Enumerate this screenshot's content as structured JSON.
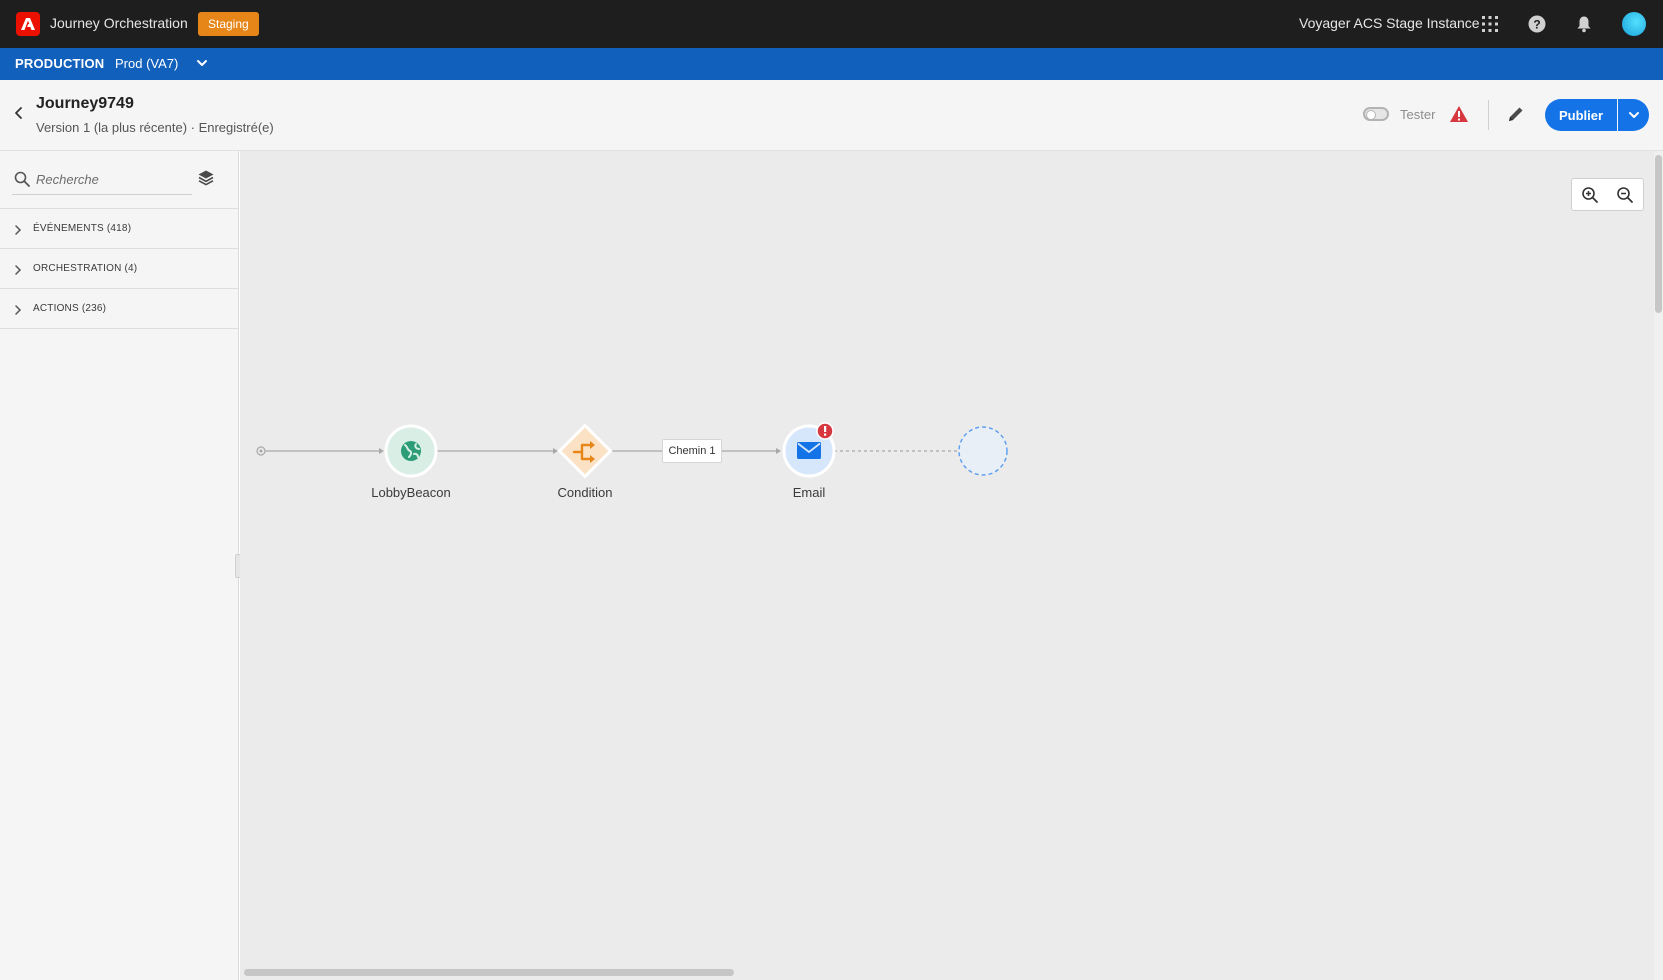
{
  "topbar": {
    "app_title": "Journey Orchestration",
    "env_badge": "Staging",
    "instance_name": "Voyager ACS Stage Instance",
    "icons": [
      "app-switcher-icon",
      "help-icon",
      "notifications-icon",
      "avatar"
    ]
  },
  "orgbar": {
    "environment": "PRODUCTION",
    "sandbox": "Prod (VA7)"
  },
  "journey": {
    "name": "Journey9749",
    "version": "Version 1 (la plus récente) · Enregistré(e)",
    "tester_label": "Tester",
    "tester_enabled": false,
    "publish_label": "Publier"
  },
  "left_panel": {
    "search_placeholder": "Recherche",
    "categories": [
      {
        "label": "ÉVÉNEMENTS (418)"
      },
      {
        "label": "ORCHESTRATION (4)"
      },
      {
        "label": "ACTIONS (236)"
      }
    ]
  },
  "canvas": {
    "nodes": [
      {
        "label": "LobbyBeacon",
        "type": "event"
      },
      {
        "label": "Condition",
        "type": "condition"
      },
      {
        "label": "Email",
        "type": "action",
        "has_error": true
      }
    ],
    "path_label": "Chemin 1"
  },
  "colors": {
    "topbar": "#1e1e1e",
    "orgbar": "#1160bb",
    "staging": "#e68619",
    "primary": "#1473e6",
    "event_node": "#2d9d78",
    "condition_node": "#e68619",
    "email_node": "#1473e6",
    "error": "#d7373f"
  }
}
